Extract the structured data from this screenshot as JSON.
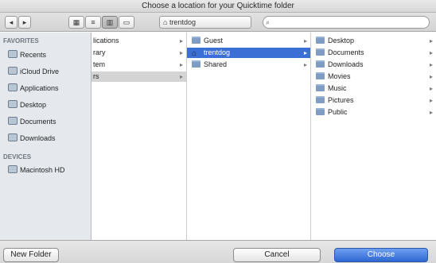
{
  "window": {
    "title": "Choose a location for your Quicktime folder"
  },
  "toolbar": {
    "back": "◂",
    "forward": "▸",
    "view_icons": "▦",
    "view_list": "≡",
    "view_columns": "▥",
    "view_flow": "▭",
    "location": "trentdog",
    "search_placeholder": ""
  },
  "sidebar": {
    "favorites_header": "FAVORITES",
    "favorites": [
      {
        "label": "Recents",
        "icon": "clock-icon"
      },
      {
        "label": "iCloud Drive",
        "icon": "cloud-icon"
      },
      {
        "label": "Applications",
        "icon": "applications-icon"
      },
      {
        "label": "Desktop",
        "icon": "desktop-icon"
      },
      {
        "label": "Documents",
        "icon": "document-icon"
      },
      {
        "label": "Downloads",
        "icon": "download-icon"
      }
    ],
    "devices_header": "DEVICES",
    "devices": [
      {
        "label": "Macintosh HD",
        "icon": "disk-icon"
      }
    ]
  },
  "column1": {
    "rows": [
      {
        "label": "lications",
        "selected": false
      },
      {
        "label": "rary",
        "selected": false
      },
      {
        "label": "tem",
        "selected": false
      },
      {
        "label": "rs",
        "selected": true
      }
    ]
  },
  "column2": {
    "rows": [
      {
        "label": "Guest",
        "icon": "folder-icon",
        "selected": false
      },
      {
        "label": "trentdog",
        "icon": "home-icon",
        "selected": true
      },
      {
        "label": "Shared",
        "icon": "folder-icon",
        "selected": false
      }
    ]
  },
  "column3": {
    "rows": [
      {
        "label": "Desktop"
      },
      {
        "label": "Documents"
      },
      {
        "label": "Downloads"
      },
      {
        "label": "Movies"
      },
      {
        "label": "Music"
      },
      {
        "label": "Pictures"
      },
      {
        "label": "Public"
      }
    ]
  },
  "footer": {
    "new_folder": "New Folder",
    "cancel": "Cancel",
    "choose": "Choose"
  }
}
